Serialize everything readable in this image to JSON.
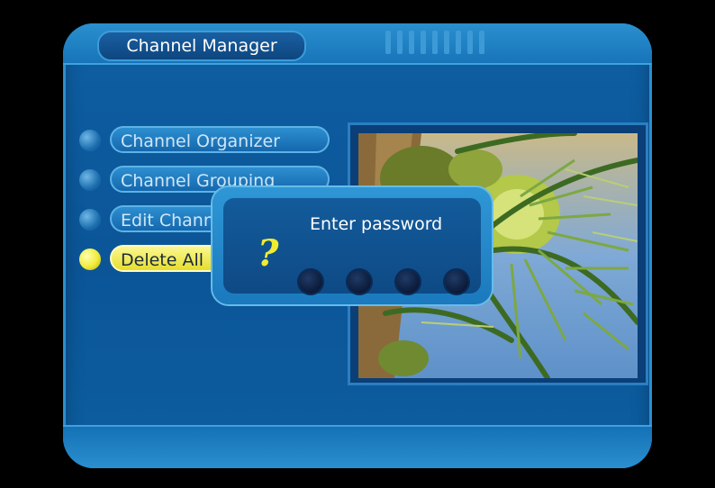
{
  "header": {
    "title": "Channel Manager"
  },
  "menu": {
    "items": [
      {
        "label": "Channel Organizer",
        "selected": false
      },
      {
        "label": "Channel Grouping",
        "selected": false
      },
      {
        "label": "Edit Channel",
        "selected": false
      },
      {
        "label": "Delete All",
        "selected": true
      }
    ]
  },
  "dialog": {
    "title": "Enter password",
    "icon": "question-mark",
    "icon_text": "?",
    "digits_entered": 0,
    "digit_count": 4
  },
  "preview": {
    "content": "video-preview"
  },
  "colors": {
    "panel": "#0e5fa3",
    "accent": "#2a90cf",
    "selected": "#f0ec3a",
    "question_mark": "#f1ec32"
  }
}
